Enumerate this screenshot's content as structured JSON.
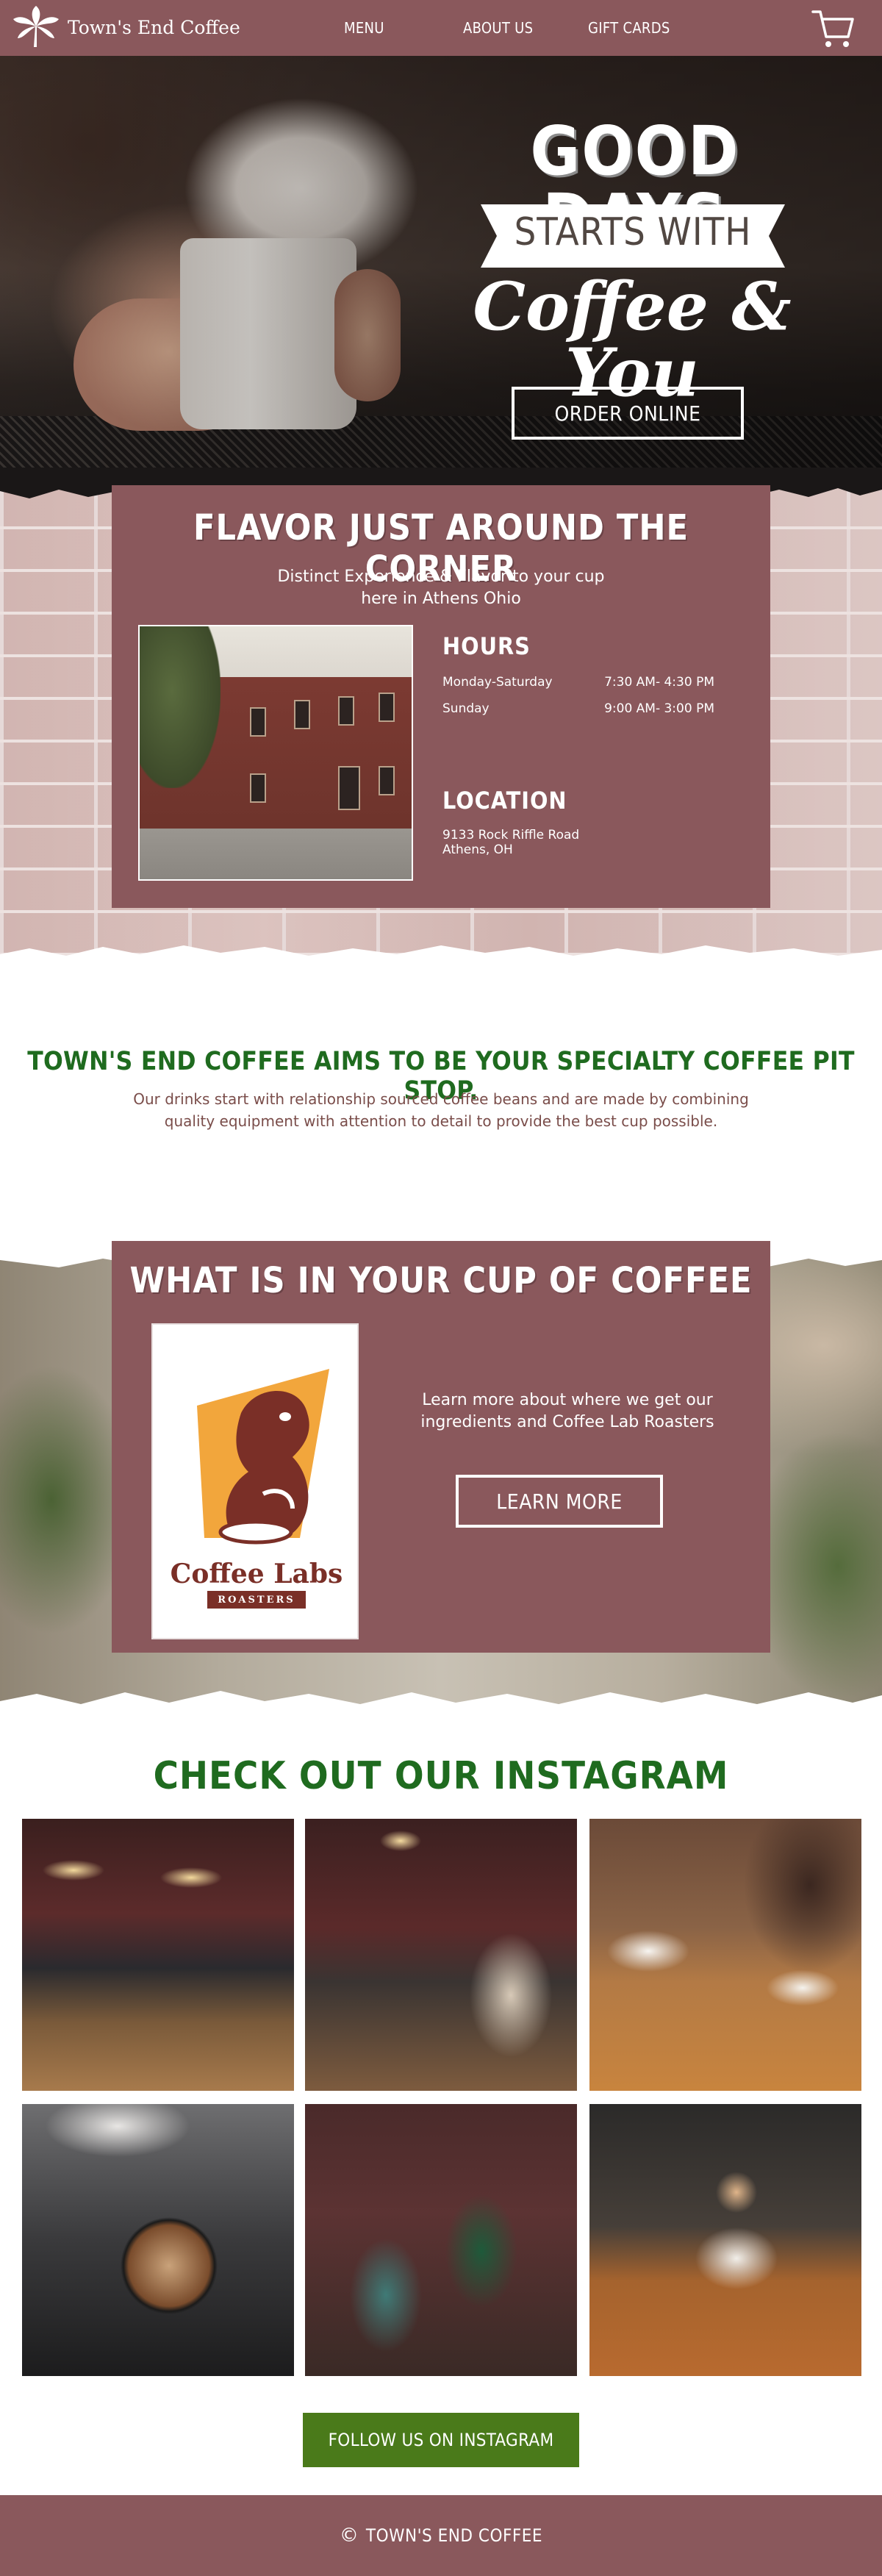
{
  "brand": {
    "name": "Town's End Coffee"
  },
  "nav": {
    "items": [
      "MENU",
      "ABOUT US",
      "GIFT CARDS"
    ],
    "cart_icon": "cart-icon"
  },
  "hero": {
    "line1": "GOOD DAYS",
    "line2": "STARTS WITH",
    "line3": "Coffee & You",
    "cta": "ORDER ONLINE"
  },
  "info": {
    "title": "FLAVOR JUST AROUND THE CORNER",
    "subtitle_line1": "Distinct Experience & Flavor to your cup",
    "subtitle_line2": "here in Athens Ohio",
    "hours_heading": "HOURS",
    "hours": [
      {
        "days": "Monday-Saturday",
        "time": "7:30 AM- 4:30 PM"
      },
      {
        "days": "Sunday",
        "time": "9:00 AM- 3:00 PM"
      }
    ],
    "location_heading": "LOCATION",
    "address_line1": "9133 Rock Riffle Road",
    "address_line2": "Athens, OH"
  },
  "mission": {
    "heading": "TOWN'S END COFFEE AIMS TO BE YOUR SPECIALTY COFFEE PIT STOP.",
    "body": "Our drinks start with relationship sourced coffee beans and are made by combining quality equipment with attention to detail to provide the best cup possible."
  },
  "cup": {
    "title": "WHAT IS IN YOUR CUP OF COFFEE",
    "logo_name": "Coffee Labs",
    "logo_sub": "ROASTERS",
    "text_line1": "Learn more about where we get our",
    "text_line2": "ingredients and Coffee Lab Roasters",
    "cta": "LEARN MORE"
  },
  "instagram": {
    "heading": "CHECK OUT OUR INSTAGRAM",
    "cta": "FOLLOW US ON INSTAGRAM"
  },
  "footer": {
    "symbol": "©",
    "text": "TOWN'S END COFFEE"
  },
  "colors": {
    "brand": "#8a585c",
    "green": "#1f6b1f",
    "button_green": "#4a7a1a"
  }
}
